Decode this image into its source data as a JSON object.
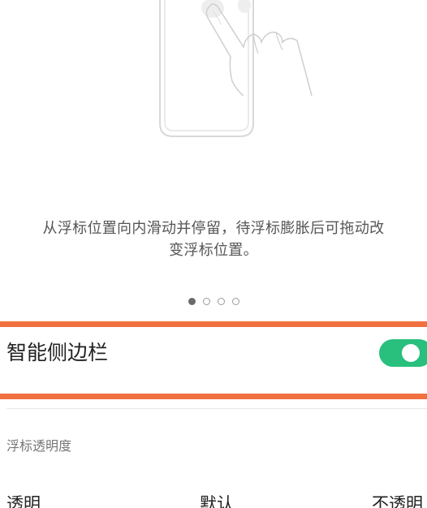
{
  "hint": {
    "text_line1": "从浮标位置向内滑动并停留，待浮标膨胀后可拖动改",
    "text_line2": "变浮标位置。"
  },
  "pager": {
    "count": 4,
    "active_index": 0
  },
  "smart_sidebar": {
    "title": "智能侧边栏",
    "enabled": true
  },
  "opacity": {
    "section_label": "浮标透明度",
    "labels": {
      "min": "透明",
      "mid": "默认",
      "max": "不透明"
    }
  },
  "colors": {
    "accent_toggle": "#28c07c",
    "highlight": "#f07040"
  }
}
